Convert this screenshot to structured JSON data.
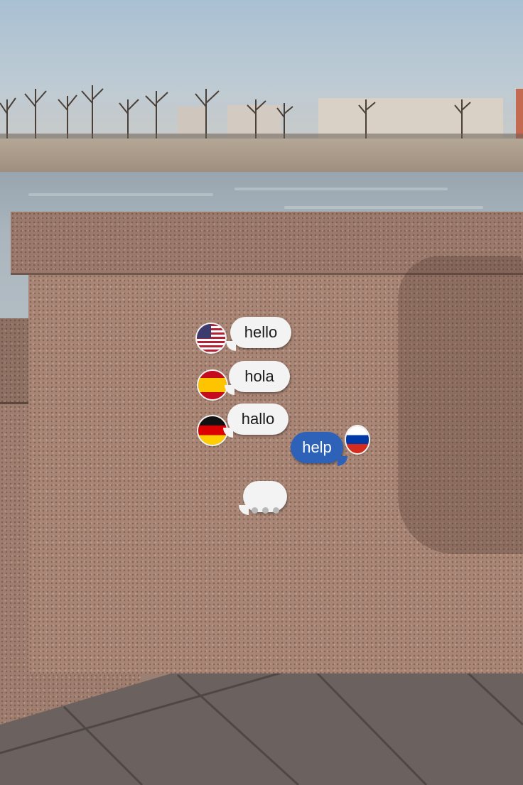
{
  "scene": {
    "description_name": "granite-parapet-stickers"
  },
  "stickers": {
    "greetings": [
      {
        "flag": "us-flag-icon",
        "text": "hello"
      },
      {
        "flag": "spain-flag-icon",
        "text": "hola"
      },
      {
        "flag": "germany-flag-icon",
        "text": "hallo"
      }
    ],
    "reply": {
      "flag": "russia-flag-icon",
      "text": "help"
    },
    "typing_indicator": "ellipsis-bubble-icon"
  },
  "colors": {
    "bubble_white": "#f3f3f3",
    "bubble_blue": "#2d62b8",
    "granite": "#a88575"
  }
}
